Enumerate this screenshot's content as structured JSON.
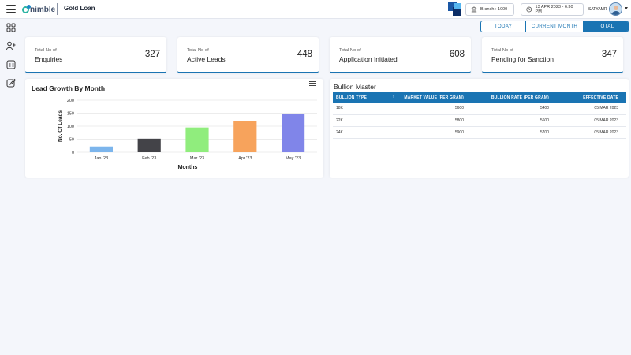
{
  "header": {
    "logo_text": "nimble",
    "app_title": "Gold Loan",
    "branch": "Branch : 1000",
    "datetime": "13 APR 2023 - 6:30 PM",
    "user_name": "SATYAMR"
  },
  "tabs": [
    {
      "label": "TODAY",
      "active": false
    },
    {
      "label": "CURRENT MONTH",
      "active": false
    },
    {
      "label": "TOTAL",
      "active": true
    }
  ],
  "stats": [
    {
      "line1": "Total No of",
      "line2": "Enquiries",
      "value": "327"
    },
    {
      "line1": "Total No of",
      "line2": "Active Leads",
      "value": "448"
    },
    {
      "line1": "Total No of",
      "line2": "Application Initiated",
      "value": "608"
    },
    {
      "line1": "Total No of",
      "line2": "Pending for Sanction",
      "value": "347"
    }
  ],
  "chart_data": {
    "type": "bar",
    "title": "Lead Growth By Month",
    "xlabel": "Months",
    "ylabel": "No. Of Leads",
    "categories": [
      "Jan '23",
      "Feb '23",
      "Mar '23",
      "Apr '23",
      "May '23"
    ],
    "values": [
      22,
      52,
      95,
      120,
      148
    ],
    "colors": [
      "#7cb5ec",
      "#434348",
      "#90ed7d",
      "#f7a35c",
      "#8085e9"
    ],
    "ylim": [
      0,
      200
    ],
    "yticks": [
      "0",
      "50",
      "100",
      "150",
      "200"
    ],
    "grid": true
  },
  "bullion": {
    "title": "Bullion Master",
    "columns": [
      "BULLION TYPE",
      "MARKET VALUE (PER GRAM)",
      "BULLION RATE (PER GRAM)",
      "EFFECTIVE DATE"
    ],
    "sort_indicator": "↑",
    "rows": [
      [
        "18K",
        "5600",
        "5400",
        "05 MAR 2023"
      ],
      [
        "22K",
        "5800",
        "5600",
        "05 MAR 2023"
      ],
      [
        "24K",
        "5900",
        "5700",
        "05 MAR 2023"
      ]
    ]
  },
  "colors": {
    "primary": "#1a74b3",
    "background": "#f4f6fb"
  }
}
